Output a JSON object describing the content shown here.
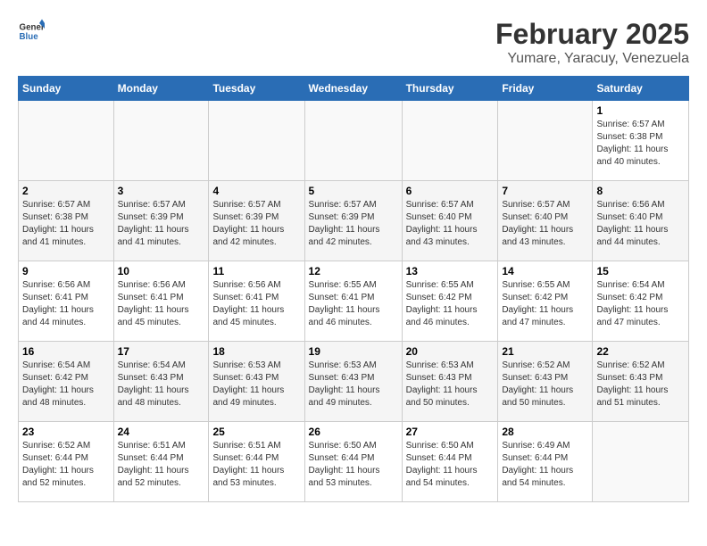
{
  "header": {
    "logo_general": "General",
    "logo_blue": "Blue",
    "main_title": "February 2025",
    "subtitle": "Yumare, Yaracuy, Venezuela"
  },
  "days_of_week": [
    "Sunday",
    "Monday",
    "Tuesday",
    "Wednesday",
    "Thursday",
    "Friday",
    "Saturday"
  ],
  "weeks": [
    [
      {
        "day": "",
        "info": ""
      },
      {
        "day": "",
        "info": ""
      },
      {
        "day": "",
        "info": ""
      },
      {
        "day": "",
        "info": ""
      },
      {
        "day": "",
        "info": ""
      },
      {
        "day": "",
        "info": ""
      },
      {
        "day": "1",
        "info": "Sunrise: 6:57 AM\nSunset: 6:38 PM\nDaylight: 11 hours\nand 40 minutes."
      }
    ],
    [
      {
        "day": "2",
        "info": "Sunrise: 6:57 AM\nSunset: 6:38 PM\nDaylight: 11 hours\nand 41 minutes."
      },
      {
        "day": "3",
        "info": "Sunrise: 6:57 AM\nSunset: 6:39 PM\nDaylight: 11 hours\nand 41 minutes."
      },
      {
        "day": "4",
        "info": "Sunrise: 6:57 AM\nSunset: 6:39 PM\nDaylight: 11 hours\nand 42 minutes."
      },
      {
        "day": "5",
        "info": "Sunrise: 6:57 AM\nSunset: 6:39 PM\nDaylight: 11 hours\nand 42 minutes."
      },
      {
        "day": "6",
        "info": "Sunrise: 6:57 AM\nSunset: 6:40 PM\nDaylight: 11 hours\nand 43 minutes."
      },
      {
        "day": "7",
        "info": "Sunrise: 6:57 AM\nSunset: 6:40 PM\nDaylight: 11 hours\nand 43 minutes."
      },
      {
        "day": "8",
        "info": "Sunrise: 6:56 AM\nSunset: 6:40 PM\nDaylight: 11 hours\nand 44 minutes."
      }
    ],
    [
      {
        "day": "9",
        "info": "Sunrise: 6:56 AM\nSunset: 6:41 PM\nDaylight: 11 hours\nand 44 minutes."
      },
      {
        "day": "10",
        "info": "Sunrise: 6:56 AM\nSunset: 6:41 PM\nDaylight: 11 hours\nand 45 minutes."
      },
      {
        "day": "11",
        "info": "Sunrise: 6:56 AM\nSunset: 6:41 PM\nDaylight: 11 hours\nand 45 minutes."
      },
      {
        "day": "12",
        "info": "Sunrise: 6:55 AM\nSunset: 6:41 PM\nDaylight: 11 hours\nand 46 minutes."
      },
      {
        "day": "13",
        "info": "Sunrise: 6:55 AM\nSunset: 6:42 PM\nDaylight: 11 hours\nand 46 minutes."
      },
      {
        "day": "14",
        "info": "Sunrise: 6:55 AM\nSunset: 6:42 PM\nDaylight: 11 hours\nand 47 minutes."
      },
      {
        "day": "15",
        "info": "Sunrise: 6:54 AM\nSunset: 6:42 PM\nDaylight: 11 hours\nand 47 minutes."
      }
    ],
    [
      {
        "day": "16",
        "info": "Sunrise: 6:54 AM\nSunset: 6:42 PM\nDaylight: 11 hours\nand 48 minutes."
      },
      {
        "day": "17",
        "info": "Sunrise: 6:54 AM\nSunset: 6:43 PM\nDaylight: 11 hours\nand 48 minutes."
      },
      {
        "day": "18",
        "info": "Sunrise: 6:53 AM\nSunset: 6:43 PM\nDaylight: 11 hours\nand 49 minutes."
      },
      {
        "day": "19",
        "info": "Sunrise: 6:53 AM\nSunset: 6:43 PM\nDaylight: 11 hours\nand 49 minutes."
      },
      {
        "day": "20",
        "info": "Sunrise: 6:53 AM\nSunset: 6:43 PM\nDaylight: 11 hours\nand 50 minutes."
      },
      {
        "day": "21",
        "info": "Sunrise: 6:52 AM\nSunset: 6:43 PM\nDaylight: 11 hours\nand 50 minutes."
      },
      {
        "day": "22",
        "info": "Sunrise: 6:52 AM\nSunset: 6:43 PM\nDaylight: 11 hours\nand 51 minutes."
      }
    ],
    [
      {
        "day": "23",
        "info": "Sunrise: 6:52 AM\nSunset: 6:44 PM\nDaylight: 11 hours\nand 52 minutes."
      },
      {
        "day": "24",
        "info": "Sunrise: 6:51 AM\nSunset: 6:44 PM\nDaylight: 11 hours\nand 52 minutes."
      },
      {
        "day": "25",
        "info": "Sunrise: 6:51 AM\nSunset: 6:44 PM\nDaylight: 11 hours\nand 53 minutes."
      },
      {
        "day": "26",
        "info": "Sunrise: 6:50 AM\nSunset: 6:44 PM\nDaylight: 11 hours\nand 53 minutes."
      },
      {
        "day": "27",
        "info": "Sunrise: 6:50 AM\nSunset: 6:44 PM\nDaylight: 11 hours\nand 54 minutes."
      },
      {
        "day": "28",
        "info": "Sunrise: 6:49 AM\nSunset: 6:44 PM\nDaylight: 11 hours\nand 54 minutes."
      },
      {
        "day": "",
        "info": ""
      }
    ]
  ]
}
